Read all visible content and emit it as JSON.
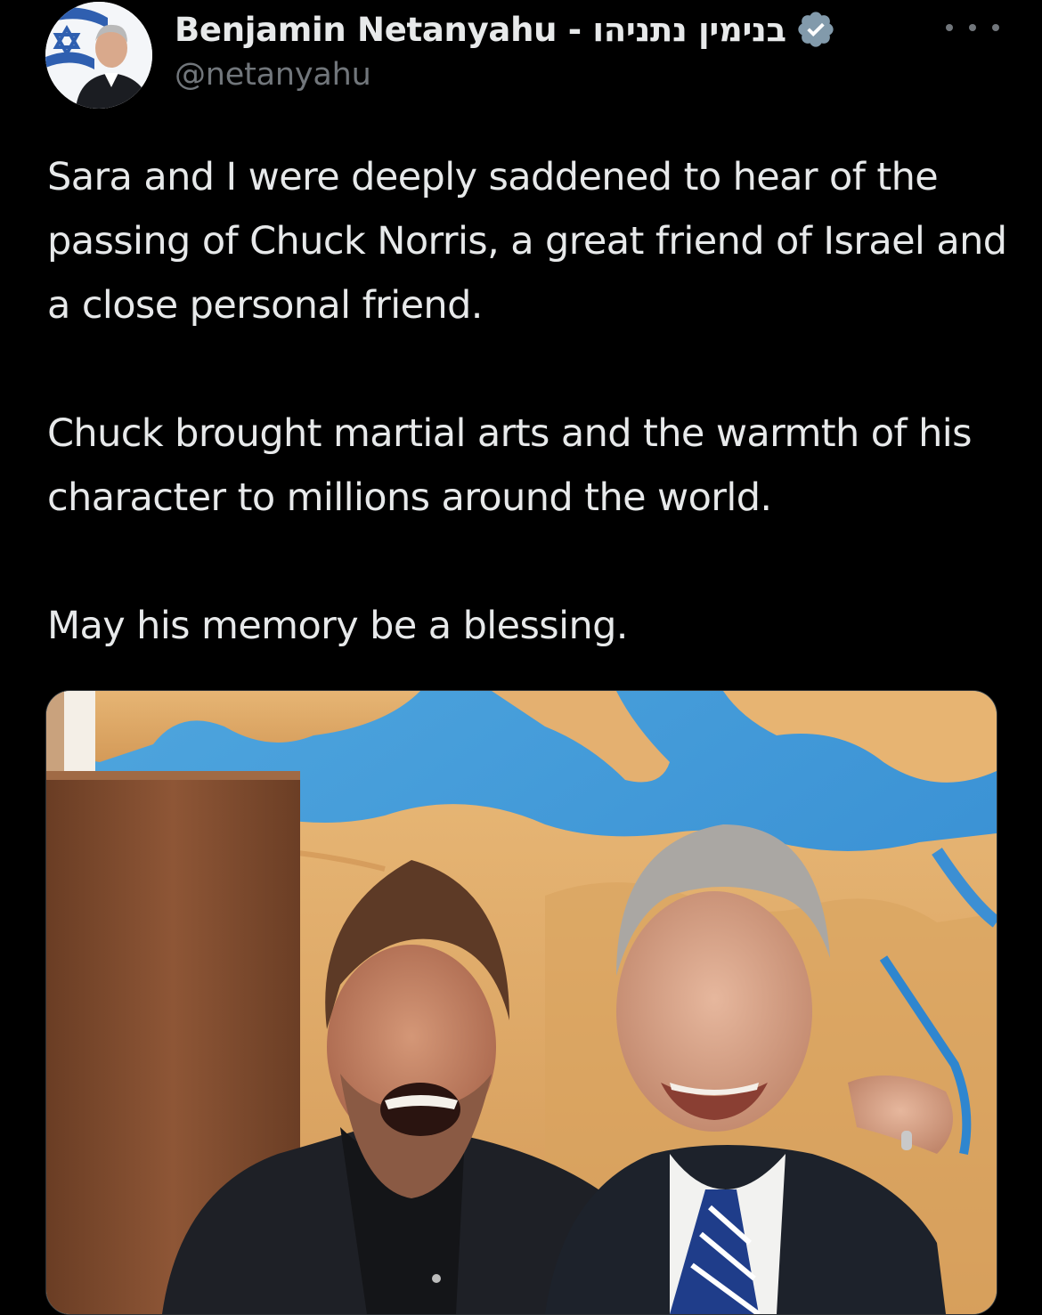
{
  "tweet": {
    "author": {
      "display_name": "Benjamin Netanyahu - בנימין נתניהו",
      "handle": "@netanyahu",
      "verified": true,
      "avatar_icon": "profile-photo-with-israeli-flag"
    },
    "more_icon": "more-horizontal-icon",
    "paragraphs": [
      "Sara and I were deeply saddened to hear of the passing of Chuck Norris, a great friend of Israel and a close personal friend.",
      "Chuck brought martial arts and the warmth of his character to millions around the world.",
      "May his memory be a blessing."
    ],
    "media": {
      "kind": "photo",
      "icon": "photo-two-men-in-front-of-map"
    }
  },
  "colors": {
    "background": "#000000",
    "text_primary": "#e7e9ea",
    "text_secondary": "#71767b",
    "verified_badge": "#829aab"
  }
}
